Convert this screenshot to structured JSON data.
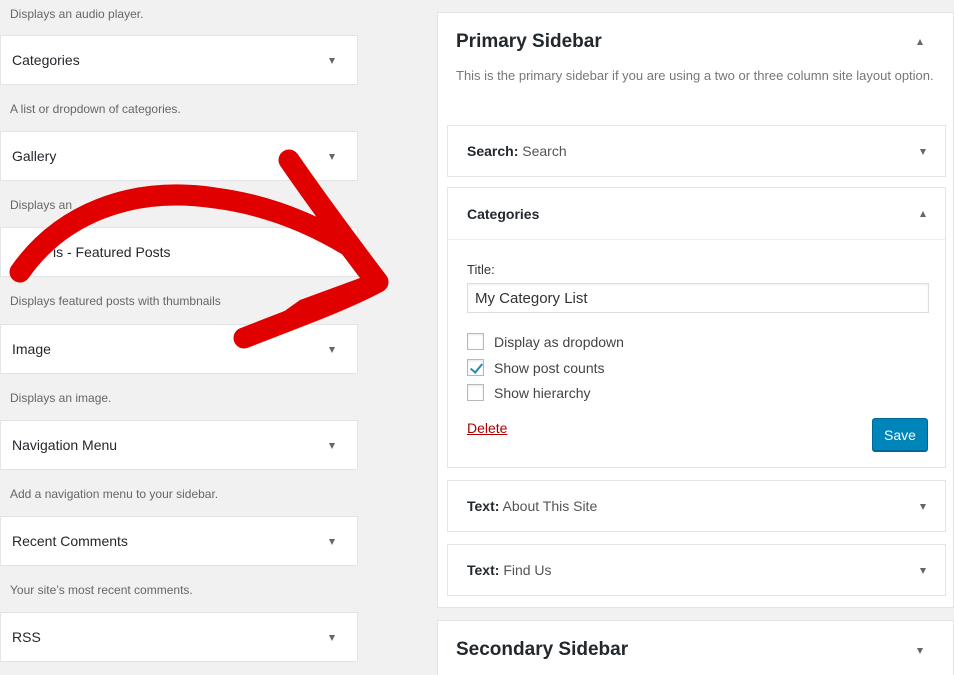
{
  "available_widgets": {
    "top_description": "Displays an audio player.",
    "items": [
      {
        "label": "Categories",
        "description": "A list or dropdown of categories."
      },
      {
        "label": "Gallery",
        "description": "Displays an"
      },
      {
        "label": "is - Featured Posts",
        "description": "Displays featured posts with thumbnails"
      },
      {
        "label": "Image",
        "description": "Displays an image."
      },
      {
        "label": "Navigation Menu",
        "description": "Add a navigation menu to your sidebar."
      },
      {
        "label": "Recent Comments",
        "description": "Your site’s most recent comments."
      },
      {
        "label": "RSS",
        "description": ""
      }
    ]
  },
  "primary_sidebar": {
    "title": "Primary Sidebar",
    "description": "This is the primary sidebar if you are using a two or three column site layout option.",
    "widgets": {
      "search": {
        "type": "Search:",
        "name": "Search"
      },
      "categories": {
        "title": "Categories",
        "title_field_label": "Title:",
        "title_field_value": "My Category List",
        "options": [
          {
            "label": "Display as dropdown",
            "checked": false
          },
          {
            "label": "Show post counts",
            "checked": true
          },
          {
            "label": "Show hierarchy",
            "checked": false
          }
        ],
        "delete_label": "Delete",
        "save_label": "Save"
      },
      "text_about": {
        "type": "Text:",
        "name": "About This Site"
      },
      "text_find": {
        "type": "Text:",
        "name": "Find Us"
      }
    }
  },
  "secondary_sidebar": {
    "title": "Secondary Sidebar"
  },
  "colors": {
    "accent": "#0085ba",
    "delete": "#aa0000",
    "annotation_arrow": "#e10000"
  },
  "icons": {
    "collapse": "arrow-down-icon",
    "expand": "arrow-up-icon",
    "checkmark": "checkmark-icon"
  }
}
